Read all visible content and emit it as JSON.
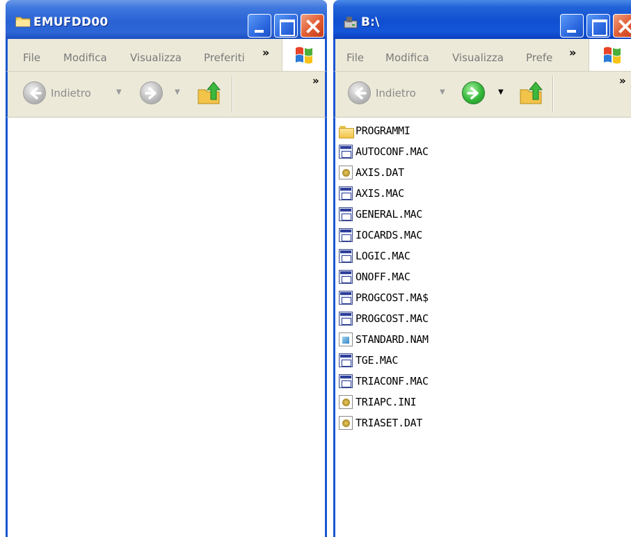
{
  "left_window": {
    "title": "EMUFDD00",
    "menu": [
      "File",
      "Modifica",
      "Visualizza",
      "Preferiti"
    ],
    "more_chevron": "»",
    "back_label": "Indietro",
    "toolbar_chevron": "»"
  },
  "right_window": {
    "title": "B:\\",
    "menu": [
      "File",
      "Modifica",
      "Visualizza",
      "Prefe"
    ],
    "more_chevron": "»",
    "back_label": "Indietro",
    "toolbar_chevron": "»",
    "files": [
      {
        "name": "PROGRAMMI",
        "icon": "folder-icon"
      },
      {
        "name": "AUTOCONF.MAC",
        "icon": "mac-file-icon"
      },
      {
        "name": "AXIS.DAT",
        "icon": "dat-file-icon"
      },
      {
        "name": "AXIS.MAC",
        "icon": "mac-file-icon"
      },
      {
        "name": "GENERAL.MAC",
        "icon": "mac-file-icon"
      },
      {
        "name": "IOCARDS.MAC",
        "icon": "mac-file-icon"
      },
      {
        "name": "LOGIC.MAC",
        "icon": "mac-file-icon"
      },
      {
        "name": "ONOFF.MAC",
        "icon": "mac-file-icon"
      },
      {
        "name": "PROGCOST.MA$",
        "icon": "mac-file-icon"
      },
      {
        "name": "PROGCOST.MAC",
        "icon": "mac-file-icon"
      },
      {
        "name": "STANDARD.NAM",
        "icon": "nam-file-icon"
      },
      {
        "name": "TGE.MAC",
        "icon": "mac-file-icon"
      },
      {
        "name": "TRIACONF.MAC",
        "icon": "mac-file-icon"
      },
      {
        "name": "TRIAPC.INI",
        "icon": "ini-file-icon"
      },
      {
        "name": "TRIASET.DAT",
        "icon": "dat-file-icon"
      }
    ]
  },
  "colors": {
    "titlebar_blue": "#0f4fd0",
    "frame_beige": "#ece9d8",
    "close_red": "#e05a30",
    "forward_green": "#34b83a"
  }
}
